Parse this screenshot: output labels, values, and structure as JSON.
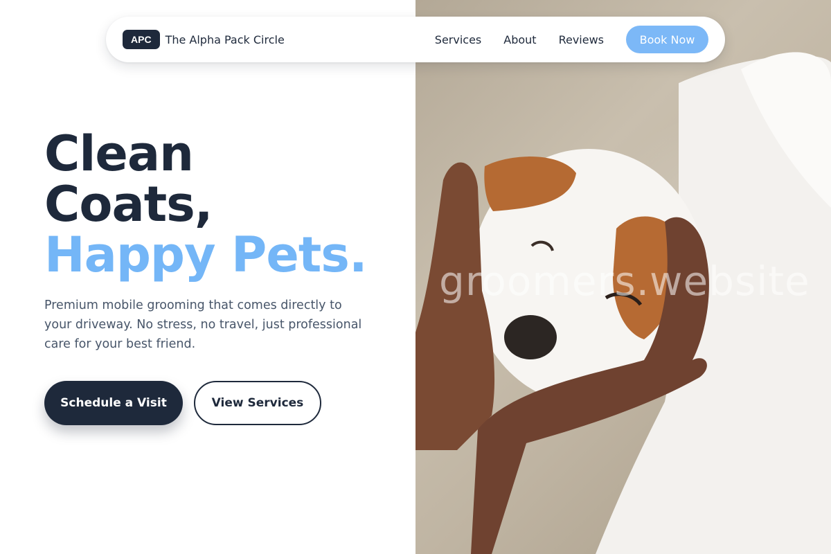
{
  "brand": {
    "badge": "APC",
    "name": "The Alpha Pack Circle"
  },
  "nav": {
    "links": [
      "Services",
      "About",
      "Reviews"
    ],
    "cta": "Book Now"
  },
  "hero": {
    "headline_line1": "Clean",
    "headline_line2": "Coats,",
    "headline_accent": "Happy Pets.",
    "description": "Premium mobile grooming that comes directly to your driveway. No stress, no travel, just professional care for your best friend.",
    "primary_button": "Schedule a Visit",
    "secondary_button": "View Services"
  },
  "image": {
    "watermark": "groomers.website",
    "subject": "puppy-cupped-in-hands-photo"
  },
  "colors": {
    "navy": "#1e293b",
    "accent_blue": "#74b6f7",
    "button_blue": "#7cb8f7",
    "body_text": "#475569"
  }
}
